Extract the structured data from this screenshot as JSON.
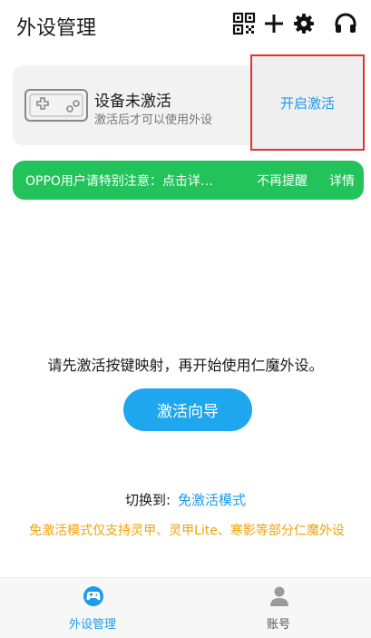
{
  "header": {
    "title": "外设管理",
    "icons": [
      "qr-code-icon",
      "plus-icon",
      "gear-icon",
      "headset-icon"
    ]
  },
  "activation_card": {
    "title": "设备未激活",
    "subtitle": "激活后才可以使用外设",
    "button_label": "开启激活"
  },
  "notice": {
    "text": "OPPO用户请特别注意：点击详…",
    "dismiss_label": "不再提醒",
    "detail_label": "详情",
    "color": "#21c35a"
  },
  "main": {
    "prompt": "请先激活按键映射，再开始使用仁魔外设。",
    "guide_button": "激活向导",
    "switch_label": "切换到:",
    "switch_link": "免激活模式",
    "warning": "免激活模式仅支持灵甲、灵甲Lite、寒影等部分仁魔外设"
  },
  "tabbar": {
    "tabs": [
      {
        "label": "外设管理",
        "icon": "gamepad-icon",
        "active": true
      },
      {
        "label": "账号",
        "icon": "person-icon",
        "active": false
      }
    ]
  },
  "colors": {
    "accent": "#1e9be8",
    "guide_button": "#1ea6ee",
    "warning": "#f2a20a",
    "highlight_border": "#e0332f"
  }
}
